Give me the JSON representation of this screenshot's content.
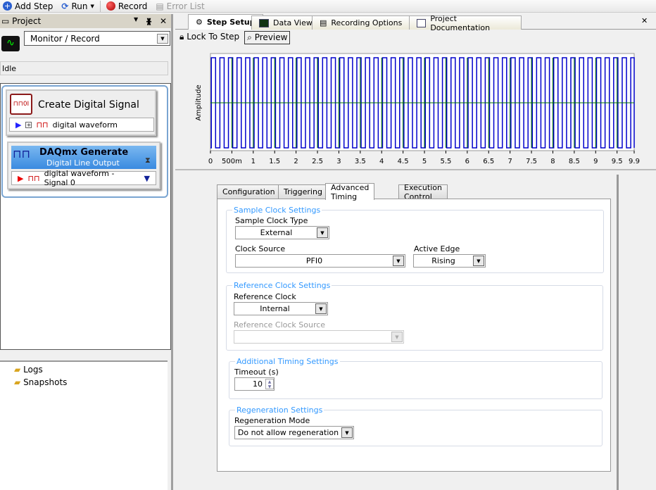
{
  "toolbar": {
    "add_step": "Add Step",
    "run": "Run",
    "record": "Record",
    "error_list": "Error List"
  },
  "project_panel": {
    "title": "Project",
    "mode": "Monitor / Record",
    "status": "Idle",
    "steps": [
      {
        "title": "Create Digital Signal",
        "io": "digital waveform"
      },
      {
        "title": "DAQmx Generate",
        "subtitle": "Digital Line Output",
        "io": "digital waveform - Signal 0"
      }
    ],
    "tree": [
      {
        "label": "Logs"
      },
      {
        "label": "Snapshots"
      }
    ]
  },
  "tabs": [
    {
      "label": "Step Setup",
      "active": true
    },
    {
      "label": "Data View"
    },
    {
      "label": "Recording Options"
    },
    {
      "label": "Project Documentation"
    }
  ],
  "step_toolbar": {
    "lock": "Lock To Step",
    "preview": "Preview"
  },
  "chart_data": {
    "type": "line",
    "ylabel": "Amplitude",
    "xlim": [
      0,
      9.9
    ],
    "ylim": [
      0,
      1
    ],
    "xticks": [
      "0",
      "500m",
      "1",
      "1.5",
      "2",
      "2.5",
      "3",
      "3.5",
      "4",
      "4.5",
      "5",
      "5.5",
      "6",
      "6.5",
      "7",
      "7.5",
      "8",
      "8.5",
      "9",
      "9.5",
      "9.9"
    ],
    "series": [
      {
        "color": "#0000cc",
        "shape": "square",
        "period": 0.2,
        "duty": 0.5,
        "low": 0,
        "high": 1
      },
      {
        "color": "#007000",
        "shape": "level-with-transitions",
        "level": 0.5,
        "transition_every": 0.5
      }
    ]
  },
  "settings": {
    "tabs": [
      "Configuration",
      "Triggering",
      "Advanced Timing",
      "Execution Control"
    ],
    "active_tab": "Advanced Timing",
    "sample_clock": {
      "legend": "Sample Clock Settings",
      "type_label": "Sample Clock Type",
      "type_value": "External",
      "source_label": "Clock Source",
      "source_value": "PFI0",
      "edge_label": "Active Edge",
      "edge_value": "Rising"
    },
    "reference_clock": {
      "legend": "Reference Clock Settings",
      "clock_label": "Reference Clock",
      "clock_value": "Internal",
      "source_label": "Reference Clock Source",
      "source_value": ""
    },
    "additional": {
      "legend": "Additional Timing Settings",
      "timeout_label": "Timeout (s)",
      "timeout_value": "10"
    },
    "regeneration": {
      "legend": "Regeneration Settings",
      "mode_label": "Regeneration Mode",
      "mode_value": "Do not allow regeneration"
    }
  }
}
